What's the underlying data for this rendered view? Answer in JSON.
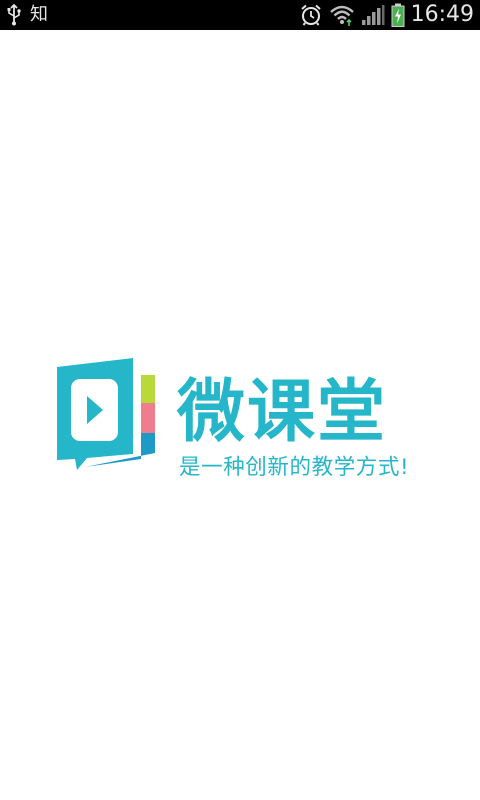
{
  "status_bar": {
    "left_text": "知",
    "time": "16:49",
    "icons": [
      "usb-icon",
      "alarm-icon",
      "wifi-icon",
      "signal-icon",
      "battery-charging-icon"
    ]
  },
  "splash": {
    "title": "微课堂",
    "slogan": "是一种创新的教学方式!",
    "colors": {
      "brand": "#25b6c9",
      "green": "#b9d93a",
      "pink": "#f07d8e",
      "blue": "#1f9ac7"
    }
  }
}
